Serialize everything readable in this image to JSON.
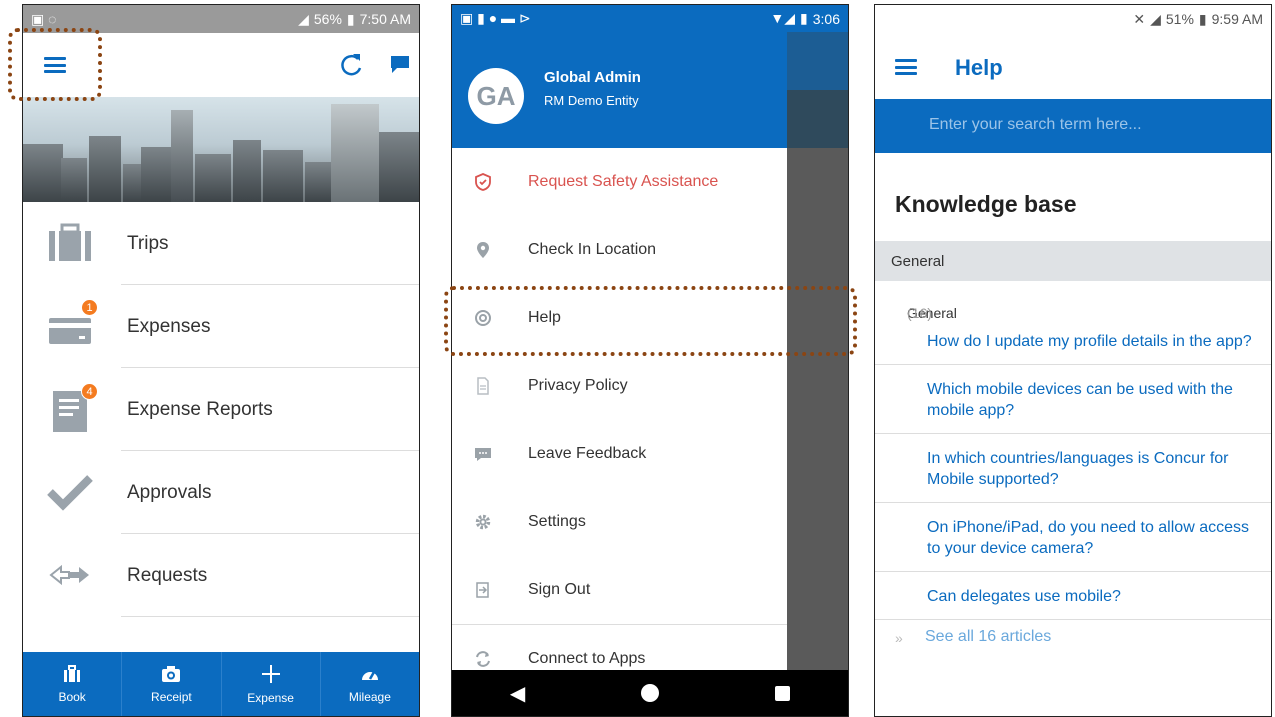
{
  "panel1": {
    "status": {
      "time": "7:50 AM",
      "battery": "56%"
    },
    "menu": [
      {
        "label": "Trips",
        "icon": "suitcase-icon",
        "badge": ""
      },
      {
        "label": "Expenses",
        "icon": "credit-card-icon",
        "badge": "1"
      },
      {
        "label": "Expense Reports",
        "icon": "report-icon",
        "badge": "4"
      },
      {
        "label": "Approvals",
        "icon": "checkmark-icon",
        "badge": ""
      },
      {
        "label": "Requests",
        "icon": "request-arrows-icon",
        "badge": ""
      }
    ],
    "tabs": [
      {
        "label": "Book",
        "icon": "suitcase-icon"
      },
      {
        "label": "Receipt",
        "icon": "camera-icon"
      },
      {
        "label": "Expense",
        "icon": "plus-icon"
      },
      {
        "label": "Mileage",
        "icon": "speedometer-icon"
      }
    ]
  },
  "panel2": {
    "status": {
      "time": "3:06"
    },
    "user": {
      "initials": "GA",
      "name": "Global Admin",
      "entity": "RM Demo Entity"
    },
    "items": [
      {
        "label": "Request Safety Assistance",
        "icon": "shield-icon"
      },
      {
        "label": "Check In Location",
        "icon": "location-pin-icon"
      },
      {
        "label": "Help",
        "icon": "lifebuoy-icon"
      },
      {
        "label": "Privacy Policy",
        "icon": "document-icon"
      },
      {
        "label": "Leave Feedback",
        "icon": "chat-bubble-icon"
      },
      {
        "label": "Settings",
        "icon": "gear-icon"
      },
      {
        "label": "Sign Out",
        "icon": "sign-out-icon"
      },
      {
        "label": "Connect to Apps",
        "icon": "sync-icon"
      }
    ],
    "colors": {
      "safety": "#d9534f",
      "accent": "#0b6bbf"
    }
  },
  "panel3": {
    "status": {
      "time": "9:59 AM",
      "battery": "51%"
    },
    "title": "Help",
    "search_placeholder": "Enter your search term here...",
    "kb_heading": "Knowledge base",
    "section": "General",
    "category": {
      "name": "General",
      "count": "(16)"
    },
    "articles": [
      "How do I update my profile details in the app?",
      "Which mobile devices can be used with the mobile app?",
      "In which countries/languages is Concur for Mobile supported?",
      "On iPhone/iPad, do you need to allow access to your device camera?",
      "Can delegates use mobile?"
    ],
    "see_all": "See all 16 articles"
  }
}
